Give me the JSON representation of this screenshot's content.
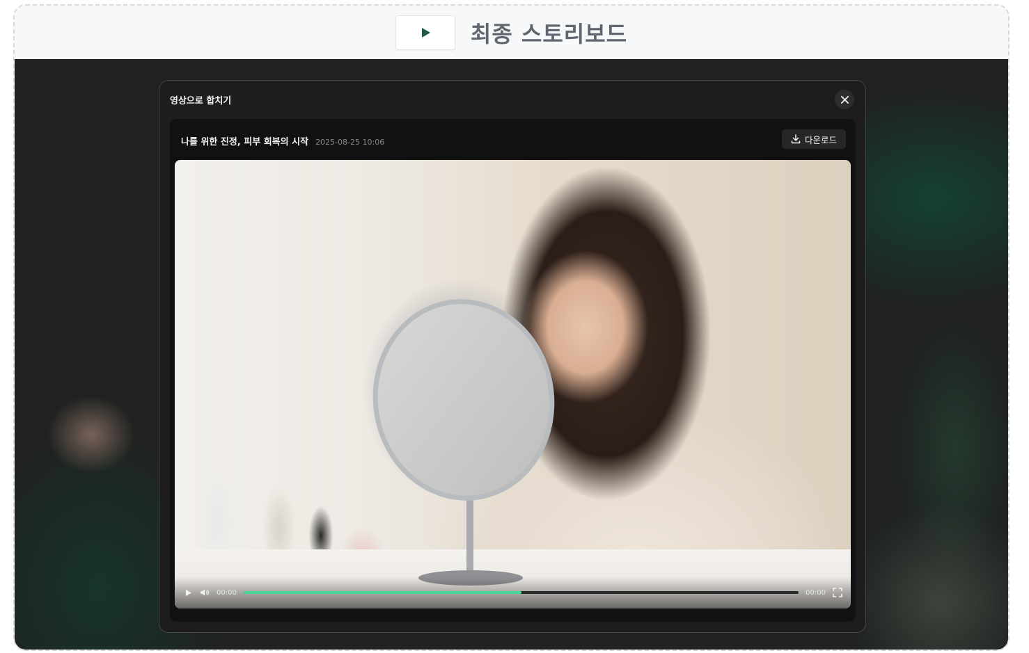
{
  "header": {
    "title": "최종 스토리보드",
    "play_icon": "play-icon",
    "accent_color": "#1f5c42"
  },
  "modal": {
    "title": "영상으로 합치기",
    "close_icon": "close-icon",
    "video": {
      "title": "나를 위한 진정, 피부 회복의 시작",
      "date": "2025-08-25 10:06",
      "download_label": "다운로드",
      "download_icon": "download-icon",
      "player": {
        "current_time": "00:00",
        "duration": "00:00",
        "progress": 0.5,
        "progress_color": "#4fd49c",
        "play_icon": "play-icon",
        "volume_icon": "volume-icon",
        "fullscreen_icon": "fullscreen-icon"
      }
    }
  }
}
